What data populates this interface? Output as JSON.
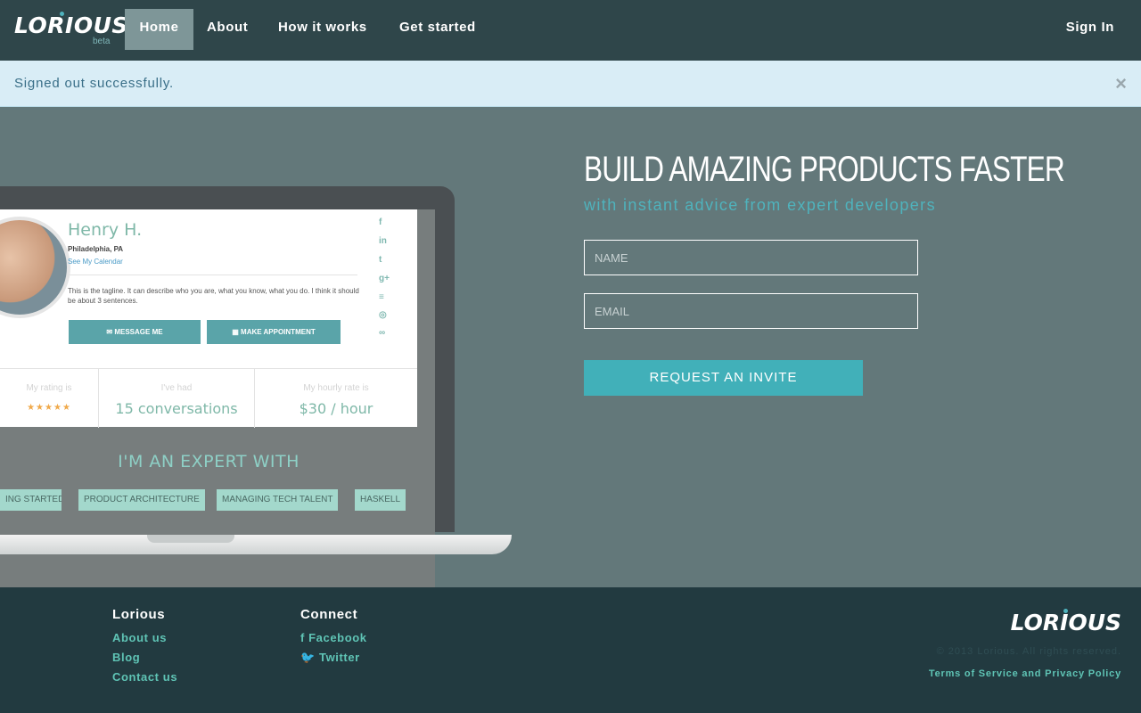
{
  "nav": {
    "logo": "LORIOUS",
    "logo_badge": "beta",
    "items": [
      {
        "label": "Home",
        "active": true
      },
      {
        "label": "About",
        "active": false
      },
      {
        "label": "How it works",
        "active": false
      },
      {
        "label": "Get started",
        "active": false
      }
    ],
    "signin": "Sign In"
  },
  "alert": {
    "message": "Signed out successfully.",
    "close": "×"
  },
  "preview": {
    "name": "Henry H.",
    "location": "Philadelphia, PA",
    "calendar_link": "See My Calendar",
    "tagline": "This is the tagline. It can describe who you are, what you know, what you do. I think it should be about 3 sentences.",
    "message_button": "✉ MESSAGE ME",
    "appointment_button": "▦ MAKE APPOINTMENT",
    "social_icons": [
      "facebook-icon",
      "linkedin-icon",
      "twitter-icon",
      "google-plus-icon",
      "stackoverflow-icon",
      "github-icon",
      "link-icon"
    ],
    "social_glyphs": [
      "f",
      "in",
      "t",
      "g+",
      "≡",
      "◎",
      "∞"
    ],
    "stats": {
      "rating_label": "My rating is",
      "rating_stars": "★★★★★",
      "rating_value": 4.5,
      "conversations_label": "I've had",
      "conversations_value": "15 conversations",
      "rate_label": "My hourly rate is",
      "rate_value": "$30 / hour"
    },
    "expert_title": "I'M AN EXPERT WITH",
    "skills": [
      "ING STARTED",
      "PRODUCT ARCHITECTURE",
      "MANAGING TECH TALENT",
      "HASKELL"
    ]
  },
  "signup": {
    "headline": "BUILD AMAZING PRODUCTS FASTER",
    "subheadline": "with instant advice from expert developers",
    "name_placeholder": "NAME",
    "email_placeholder": "EMAIL",
    "button": "REQUEST AN INVITE"
  },
  "footer": {
    "col1_title": "Lorious",
    "col1_links": [
      "About us",
      "Blog",
      "Contact us"
    ],
    "col2_title": "Connect",
    "col2_links": [
      "f Facebook",
      "🐦 Twitter"
    ],
    "logo": "LORIOUS",
    "copyright": "© 2013 Lorious. All rights reserved.",
    "terms": "Terms of Service and Privacy Policy"
  },
  "colors": {
    "nav_bg": "#2f464a",
    "hero_bg": "#63787a",
    "accent": "#41b0b9",
    "alert_bg": "#d9edf6",
    "footer_bg": "#223a40"
  }
}
